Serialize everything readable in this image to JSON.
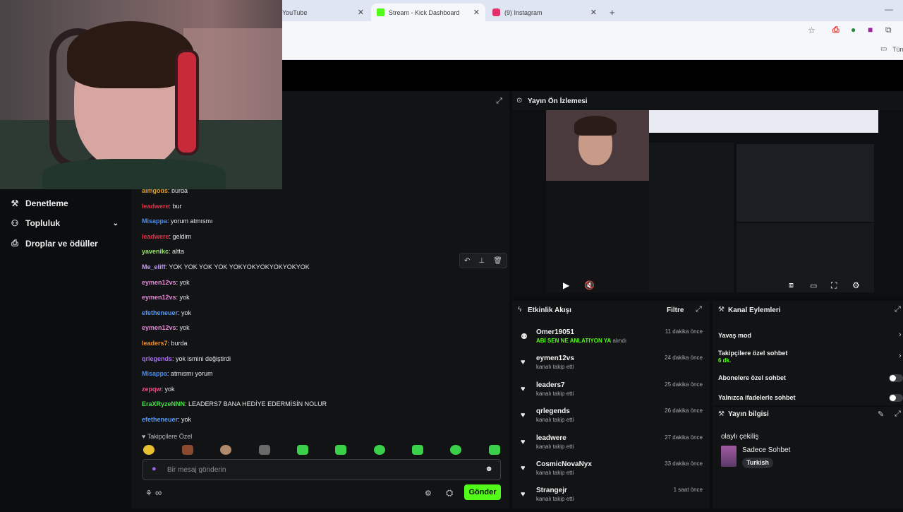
{
  "browser": {
    "tabs": [
      {
        "label": "YouTube",
        "active": false
      },
      {
        "label": "Stream - Kick Dashboard",
        "active": true
      },
      {
        "label": "(9) Instagram",
        "active": false
      }
    ],
    "new_tab": "+",
    "bookmark_label": "Tüm"
  },
  "sidebar": {
    "items": [
      {
        "label": "Denetleme",
        "icon": "gavel-icon"
      },
      {
        "label": "Topluluk",
        "icon": "people-icon"
      },
      {
        "label": "Droplar ve ödüller",
        "icon": "gift-icon"
      }
    ]
  },
  "chat": {
    "messages": [
      {
        "user": "aimgods",
        "text": "burda",
        "color": "#e0a030"
      },
      {
        "user": "leadwere",
        "text": "bur",
        "color": "#e0304a"
      },
      {
        "user": "Misappa",
        "text": "yorum atmısmı",
        "color": "#4a8cf0"
      },
      {
        "user": "leadwere",
        "text": "geldim",
        "color": "#e0304a"
      },
      {
        "user": "yavenikc",
        "text": "altta",
        "color": "#9be86a"
      },
      {
        "user": "Me_eliff",
        "text": "YOK YOK YOK YOK YOKYOKYOKYOKYOKYOK",
        "color": "#c59cf5"
      },
      {
        "user": "eymen12vs",
        "text": "yok",
        "color": "#e48ad4"
      },
      {
        "user": "eymen12vs",
        "text": "yok",
        "color": "#e48ad4"
      },
      {
        "user": "efetheneuer",
        "text": "yok",
        "color": "#5a9af2"
      },
      {
        "user": "eymen12vs",
        "text": "yok",
        "color": "#e48ad4"
      },
      {
        "user": "leaders7",
        "text": "burda",
        "color": "#f0902a"
      },
      {
        "user": "qrlegends",
        "text": "yok ismini değiştirdi",
        "color": "#a86cf0"
      },
      {
        "user": "Misappa",
        "text": "atmısmı yorum",
        "color": "#4a8cf0"
      },
      {
        "user": "zepqw",
        "text": "yok",
        "color": "#f04a8a"
      },
      {
        "user": "EraXRyzeNNN",
        "text": "LEADERS7 BANA HEDİYE EDERMİSİN NOLUR",
        "color": "#4ae04a"
      },
      {
        "user": "efetheneuer",
        "text": "yok",
        "color": "#5a9af2"
      }
    ],
    "followers_only_label": "Takipçilere Özel",
    "input_placeholder": "Bir mesaj gönderin",
    "send_label": "Gönder",
    "infinity_label": "∞"
  },
  "preview": {
    "title": "Yayın Ön İzlemesi"
  },
  "activity": {
    "title": "Etkinlik Akışı",
    "filter_label": "Filtre",
    "items": [
      {
        "name": "Omer19051",
        "sub": "ABİ SEN NE ANLATIYON YA",
        "sub_suffix": "alındı",
        "time": "11 dakika önce",
        "icon": "people-icon"
      },
      {
        "name": "eymen12vs",
        "sub": "kanalı takip etti",
        "time": "24 dakika önce",
        "icon": "heart-icon"
      },
      {
        "name": "leaders7",
        "sub": "kanalı takip etti",
        "time": "25 dakika önce",
        "icon": "heart-icon"
      },
      {
        "name": "qrlegends",
        "sub": "kanalı takip etti",
        "time": "26 dakika önce",
        "icon": "heart-icon"
      },
      {
        "name": "leadwere",
        "sub": "kanalı takip etti",
        "time": "27 dakika önce",
        "icon": "heart-icon"
      },
      {
        "name": "CosmicNovaNyx",
        "sub": "kanalı takip etti",
        "time": "33 dakika önce",
        "icon": "heart-icon"
      },
      {
        "name": "Strangejr",
        "sub": "kanalı takip etti",
        "time": "1 saat önce",
        "icon": "heart-icon"
      }
    ]
  },
  "channel_actions": {
    "title": "Kanal Eylemleri",
    "slow_mode": "Yavaş mod",
    "followers_only": "Takipçilere özel sohbet",
    "followers_only_duration": "6 dk.",
    "subscribers_only": "Abonelere özel sohbet",
    "emotes_only": "Yalnızca ifadelerle sohbet"
  },
  "stream_info": {
    "title": "Yayın bilgisi",
    "stream_title": "olaylı çekiliş",
    "category": "Sadece Sohbet",
    "language": "Turkish"
  },
  "colors": {
    "accent": "#53fc18",
    "panel": "#111315",
    "background": "#0b0d0f"
  }
}
